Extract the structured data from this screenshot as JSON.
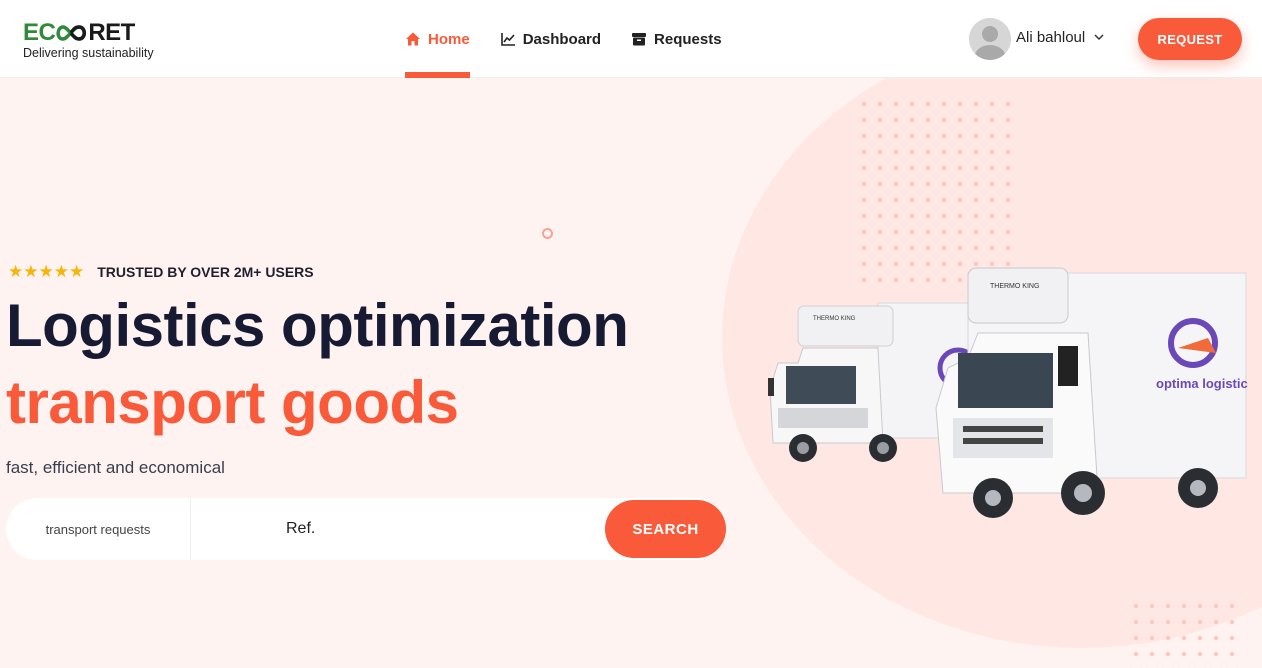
{
  "brand": {
    "logo_left": "EC",
    "logo_right": "RET",
    "tagline": "Delivering sustainability",
    "colors": {
      "green": "#2f8a3a",
      "accent": "#f85a3a",
      "dark": "#161a33"
    }
  },
  "nav": {
    "items": [
      {
        "label": "Home",
        "icon": "home-icon",
        "active": true
      },
      {
        "label": "Dashboard",
        "icon": "chart-line-icon",
        "active": false
      },
      {
        "label": "Requests",
        "icon": "archive-box-icon",
        "active": false
      }
    ]
  },
  "user": {
    "name": "Ali bahloul"
  },
  "header": {
    "request_label": "REQUEST"
  },
  "hero": {
    "rating_stars": "★★★★★",
    "rating_text": "TRUSTED BY OVER 2M+ USERS",
    "title_line1": "Logistics optimization",
    "title_line2": "transport goods",
    "subtitle": "fast, efficient and economical"
  },
  "search": {
    "category": "transport requests",
    "placeholder": "Ref.",
    "button_label": "SEARCH"
  },
  "trucks": {
    "reefer_label_small": "THERMO KING",
    "reefer_label_big": "THERMO KING",
    "brand_text": "optima logistic"
  }
}
